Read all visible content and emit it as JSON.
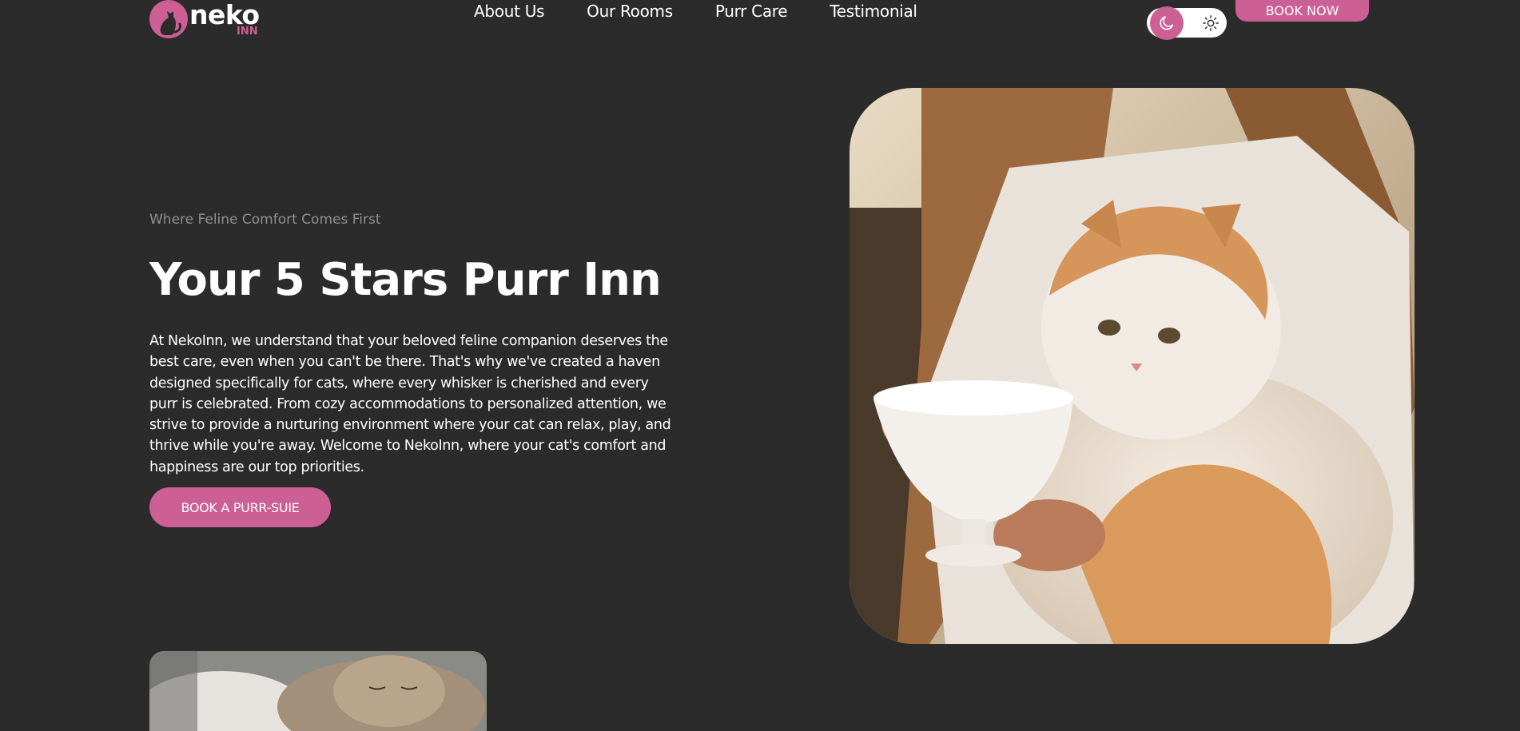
{
  "header": {
    "logo": {
      "word": "neko",
      "sub": "INN"
    },
    "nav": [
      "About Us",
      "Our Rooms",
      "Purr Care",
      "Testimonial"
    ],
    "theme_toggle": {
      "dark_icon": "moon-icon",
      "light_icon": "sun-icon",
      "active": "dark"
    },
    "book_now_label": "BOOK NOW"
  },
  "hero": {
    "eyebrow": "Where Feline Comfort Comes First",
    "title": "Your 5 Stars Purr Inn",
    "body": "At NekoInn, we understand that your beloved feline companion deserves the best care, even when you can't be there. That's why we've created a haven designed specifically for cats, where every whisker is cherished and every purr is celebrated. From cozy accommodations to personalized attention, we strive to provide a nurturing environment where your cat can relax, play, and thrive while you're away. Welcome to NekoInn, where your cat's comfort and happiness are our top priorities.",
    "cta_label": "BOOK A PURR-SUIE"
  },
  "colors": {
    "background": "#2b2b2b",
    "accent": "#cc5f93",
    "text": "#ffffff",
    "muted": "#8f8f8f"
  }
}
